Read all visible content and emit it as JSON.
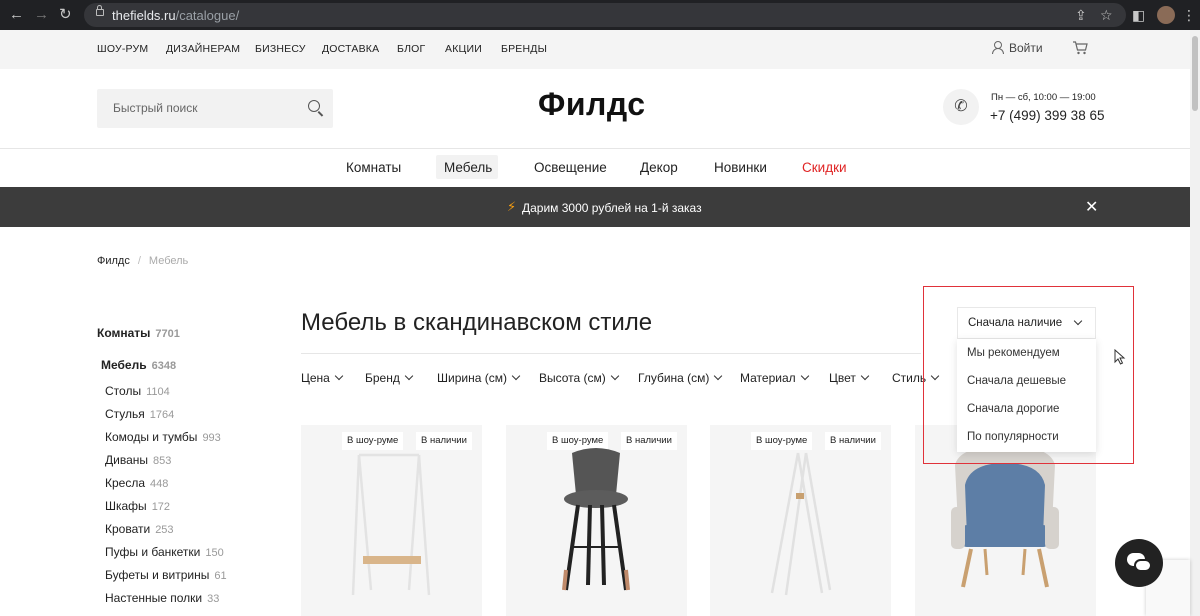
{
  "browser": {
    "url_host": "thefields.ru",
    "url_path": "/catalogue/"
  },
  "topbar": {
    "links": [
      "ШОУ-РУМ",
      "ДИЗАЙНЕРАМ",
      "БИЗНЕСУ",
      "ДОСТАВКА",
      "БЛОГ",
      "АКЦИИ",
      "БРЕНДЫ"
    ],
    "login_label": "Войти"
  },
  "header": {
    "search_placeholder": "Быстрый поиск",
    "logo": "Филдс",
    "hours": "Пн — сб, 10:00 — 19:00",
    "phone": "+7 (499) 399 38 65"
  },
  "catnav": {
    "items": [
      "Комнаты",
      "Мебель",
      "Освещение",
      "Декор",
      "Новинки",
      "Скидки"
    ],
    "active": "Мебель",
    "sale_color": "#e02424"
  },
  "promo": {
    "text": "Дарим 3000 рублей на 1-й заказ",
    "bolt_color": "#f39c12"
  },
  "breadcrumb": {
    "home": "Филдс",
    "separator": "/",
    "current": "Мебель"
  },
  "sidebar": {
    "rooms": {
      "label": "Комнаты",
      "count": "7701"
    },
    "furniture": {
      "label": "Мебель",
      "count": "6348"
    },
    "items": [
      {
        "label": "Столы",
        "count": "1104"
      },
      {
        "label": "Стулья",
        "count": "1764"
      },
      {
        "label": "Комоды и тумбы",
        "count": "993"
      },
      {
        "label": "Диваны",
        "count": "853"
      },
      {
        "label": "Кресла",
        "count": "448"
      },
      {
        "label": "Шкафы",
        "count": "172"
      },
      {
        "label": "Кровати",
        "count": "253"
      },
      {
        "label": "Пуфы и банкетки",
        "count": "150"
      },
      {
        "label": "Буфеты и витрины",
        "count": "61"
      },
      {
        "label": "Настенные полки",
        "count": "33"
      }
    ]
  },
  "main": {
    "title": "Мебель в скандинавском стиле",
    "filters": [
      "Цена",
      "Бренд",
      "Ширина (см)",
      "Высота (см)",
      "Глубина (см)",
      "Материал",
      "Цвет",
      "Стиль"
    ]
  },
  "sort": {
    "selected": "Сначала наличие",
    "options": [
      "Мы рекомендуем",
      "Сначала дешевые",
      "Сначала дорогие",
      "По популярности"
    ],
    "highlight_color": "#e0323a"
  },
  "products": [
    {
      "badges": [
        "В шоу-руме",
        "В наличии"
      ],
      "kind": "clothes-rack"
    },
    {
      "badges": [
        "В шоу-руме",
        "В наличии"
      ],
      "kind": "bar-stool"
    },
    {
      "badges": [
        "В шоу-руме",
        "В наличии"
      ],
      "kind": "coat-stand"
    },
    {
      "badges": [],
      "kind": "armchair"
    }
  ]
}
